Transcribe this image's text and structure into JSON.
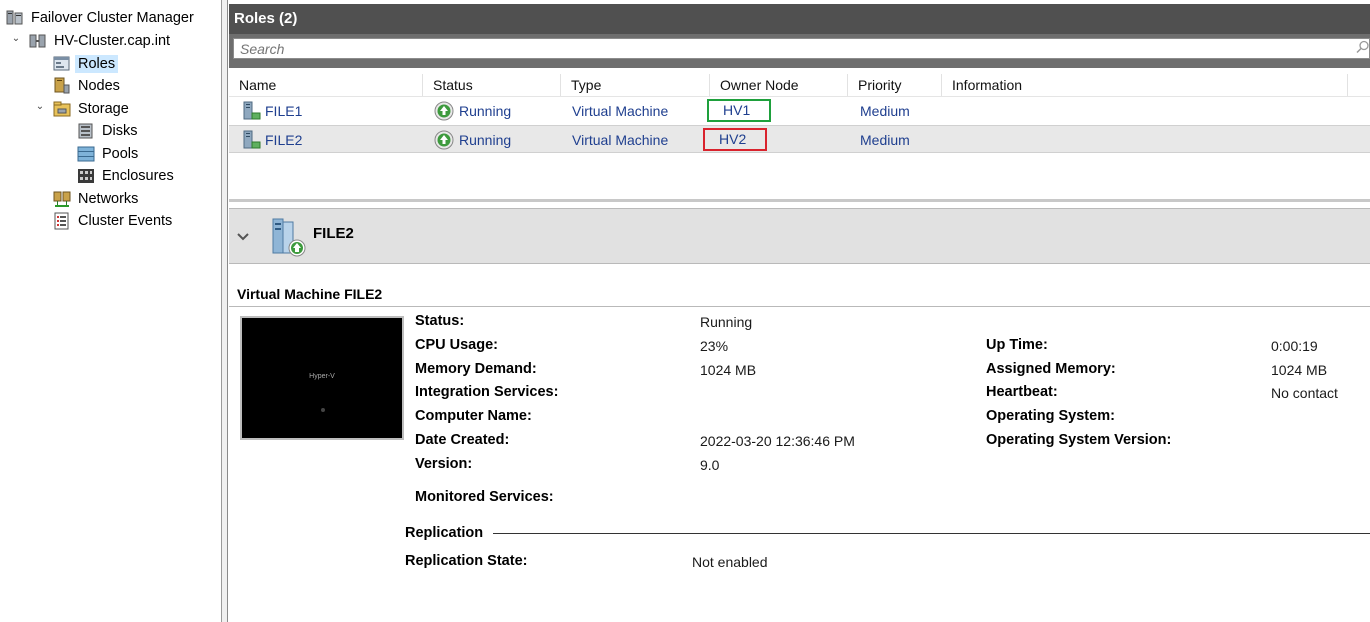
{
  "tree": {
    "items": [
      {
        "label": "Failover Cluster Manager",
        "icon": "failover-cluster-manager-icon"
      },
      {
        "label": "HV-Cluster.cap.int",
        "icon": "cluster-icon"
      },
      {
        "label": "Roles",
        "icon": "roles-icon"
      },
      {
        "label": "Nodes",
        "icon": "nodes-icon"
      },
      {
        "label": "Storage",
        "icon": "storage-icon"
      },
      {
        "label": "Disks",
        "icon": "disks-icon"
      },
      {
        "label": "Pools",
        "icon": "pools-icon"
      },
      {
        "label": "Enclosures",
        "icon": "enclosures-icon"
      },
      {
        "label": "Networks",
        "icon": "networks-icon"
      },
      {
        "label": "Cluster Events",
        "icon": "cluster-events-icon"
      }
    ],
    "selected": "Roles"
  },
  "roles": {
    "title": "Roles (2)",
    "search_placeholder": "Search",
    "columns": [
      "Name",
      "Status",
      "Type",
      "Owner Node",
      "Priority",
      "Information"
    ],
    "rows": [
      {
        "name": "FILE1",
        "status": "Running",
        "type": "Virtual Machine",
        "owner": "HV1",
        "priority": "Medium",
        "information": "",
        "highlight_color": "#1ea03c"
      },
      {
        "name": "FILE2",
        "status": "Running",
        "type": "Virtual Machine",
        "owner": "HV2",
        "priority": "Medium",
        "information": "",
        "highlight_color": "#d9232d"
      }
    ]
  },
  "detail": {
    "title": "FILE2",
    "vm_heading": "Virtual Machine FILE2",
    "thumbnail_text": "Hyper-V",
    "left_labels": [
      "Status:",
      "CPU Usage:",
      "Memory Demand:",
      "Integration Services:",
      "Computer Name:",
      "Date Created:",
      "Version:",
      "Monitored Services:"
    ],
    "left_values": [
      "Running",
      "23%",
      "1024 MB",
      "",
      "",
      "2022-03-20 12:36:46 PM",
      "9.0",
      ""
    ],
    "right_labels": [
      "Up Time:",
      "Assigned Memory:",
      "Heartbeat:",
      "Operating System:",
      "Operating System Version:"
    ],
    "right_values": [
      "0:00:19",
      "1024 MB",
      "No contact",
      "",
      ""
    ],
    "replication_heading": "Replication",
    "replication_state_label": "Replication State:",
    "replication_state_value": "Not enabled"
  }
}
